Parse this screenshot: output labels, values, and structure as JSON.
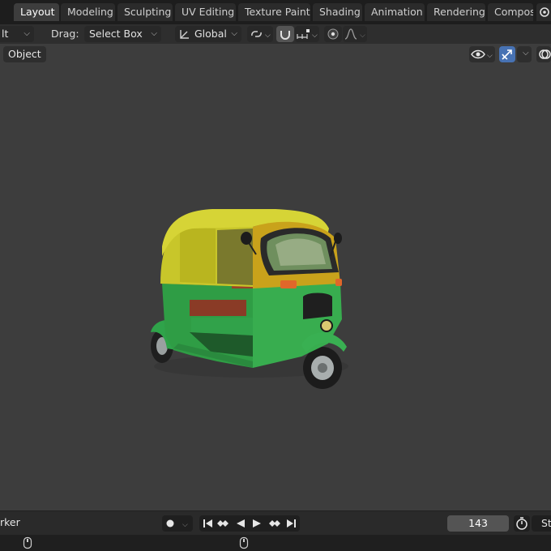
{
  "workspace_tabs": [
    {
      "label": "Layout",
      "active": true
    },
    {
      "label": "Modeling",
      "active": false
    },
    {
      "label": "Sculpting",
      "active": false
    },
    {
      "label": "UV Editing",
      "active": false
    },
    {
      "label": "Texture Paint",
      "active": false
    },
    {
      "label": "Shading",
      "active": false
    },
    {
      "label": "Animation",
      "active": false
    },
    {
      "label": "Rendering",
      "active": false
    },
    {
      "label": "Compos",
      "active": false
    }
  ],
  "header": {
    "mode_fragment": "lt",
    "drag_label": "Drag:",
    "drag_value": "Select Box",
    "orientation_value": "Global"
  },
  "viewport": {
    "mode_button": "Object"
  },
  "timeline": {
    "marker_fragment": "rker",
    "current_frame": "143",
    "start_fragment": "St"
  },
  "colors": {
    "accent_blue": "#4772b3",
    "topbar": "#1d1d1d",
    "viewport_bg": "#3d3d3d"
  }
}
